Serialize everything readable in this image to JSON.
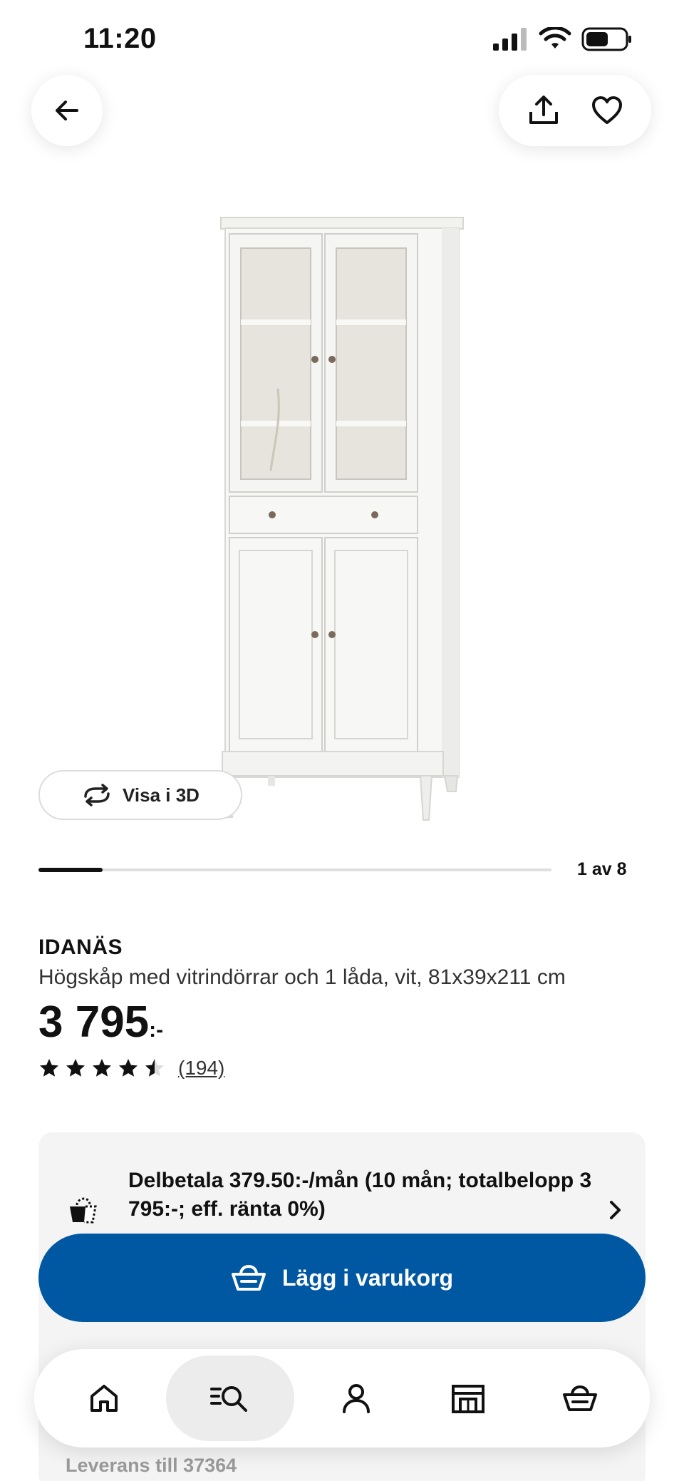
{
  "status": {
    "time": "11:20"
  },
  "header": {
    "back_icon": "arrow-left-icon",
    "share_icon": "share-icon",
    "favorite_icon": "heart-icon"
  },
  "gallery": {
    "view3d_label": "Visa i 3D",
    "counter": "1 av 8",
    "progress_fraction": 0.125
  },
  "product": {
    "brand": "IDANÄS",
    "description": "Högskåp med vitrindörrar och 1 låda, vit, 81x39x211 cm",
    "price": "3 795",
    "price_suffix": ":-",
    "rating": 4.5,
    "review_count": "(194)"
  },
  "payment": {
    "text": "Delbetala 379.50:-/mån (10 mån; totalbelopp 3 795:-; eff. ränta 0%)",
    "delivery": "Leverans till 37364"
  },
  "cart_button": {
    "label": "Lägg i varukorg"
  },
  "nav": {
    "items": [
      "home-icon",
      "search-icon",
      "profile-icon",
      "store-icon",
      "basket-icon"
    ],
    "active": "search-icon"
  },
  "colors": {
    "primary": "#0058a3",
    "card_bg": "#f4f4f4"
  }
}
